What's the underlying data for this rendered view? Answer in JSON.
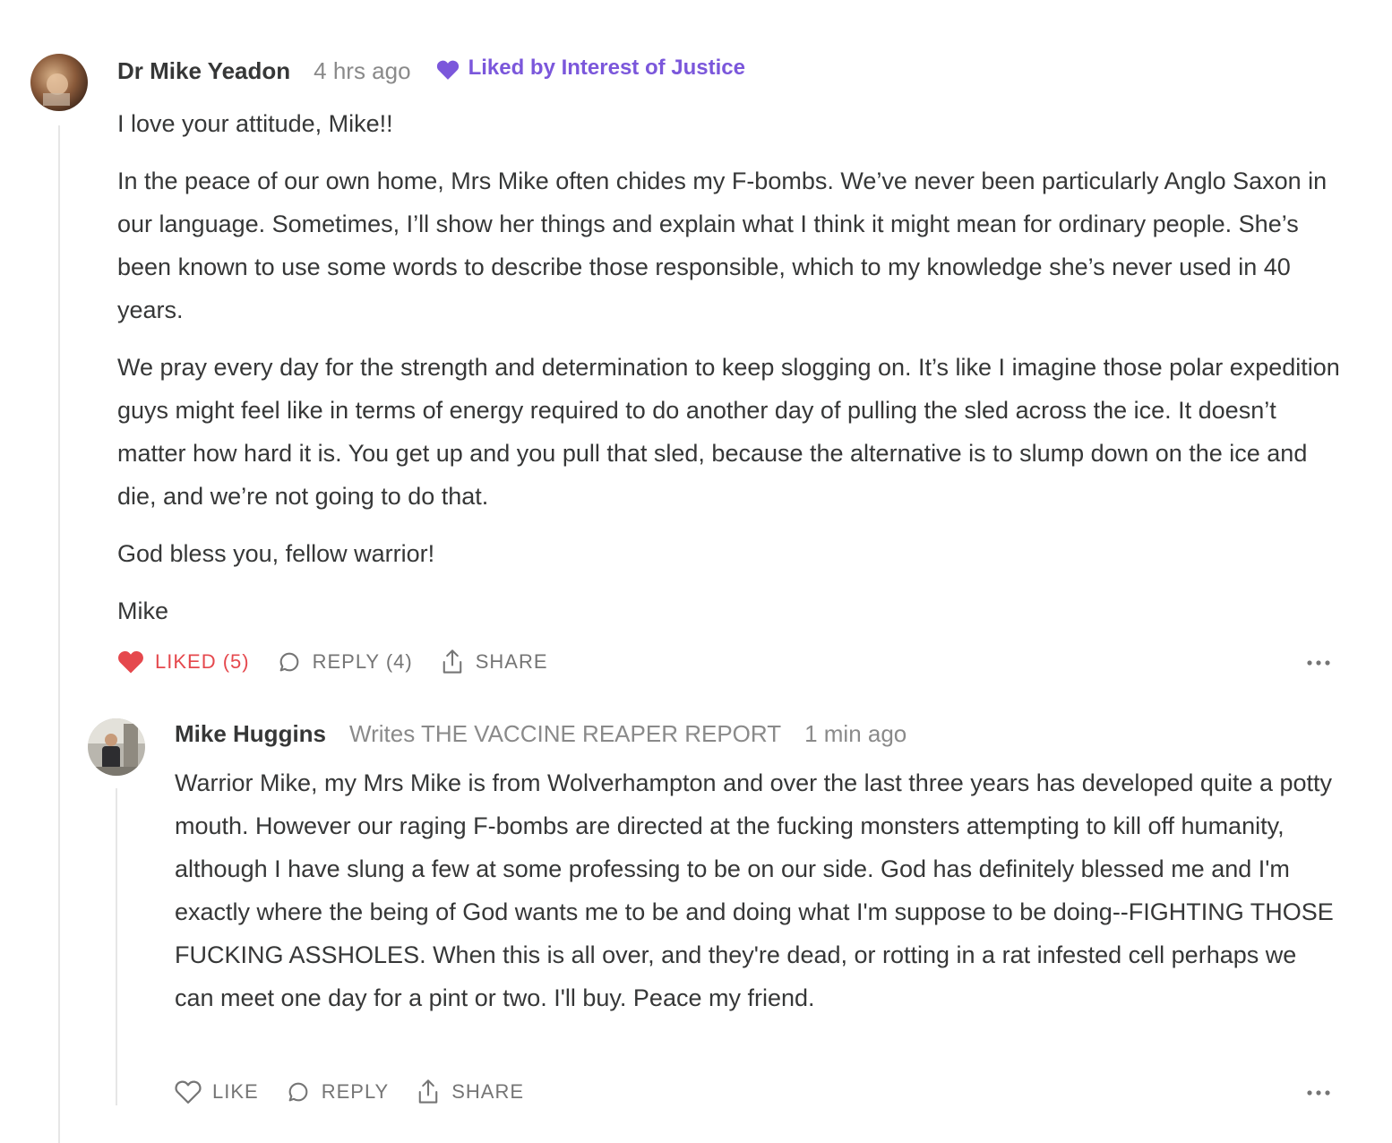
{
  "comments": [
    {
      "author": "Dr Mike Yeadon",
      "timestamp": "4 hrs ago",
      "liked_by": "Liked by Interest of Justice",
      "paragraphs": [
        "I love your attitude, Mike!!",
        "In the peace of our own home, Mrs Mike often chides my F-bombs. We’ve never been particularly Anglo Saxon in our language. Sometimes, I’ll show her things and explain what I think it might mean for ordinary people. She’s been known to use some words to describe those responsible, which to my knowledge she’s never used in 40 years.",
        "We pray every day for the strength and determination to keep slogging on. It’s like I imagine those polar expedition guys might feel like in terms of energy required to do another day of pulling the sled across the ice. It doesn’t matter how hard it is. You get up and you pull that sled, because the alternative is to slump down on the ice and die, and we’re not going to do that.",
        "God bless you, fellow warrior!",
        "Mike"
      ],
      "actions": {
        "like_label": "LIKED (5)",
        "reply_label": "REPLY (4)",
        "share_label": "SHARE"
      }
    },
    {
      "author": "Mike Huggins",
      "writes": "Writes THE VACCINE REAPER REPORT",
      "timestamp": "1 min ago",
      "paragraphs": [
        "Warrior Mike, my Mrs Mike is from Wolverhampton and over the last three years has developed quite a potty mouth. However our raging F-bombs are directed at the fucking monsters attempting to kill off humanity, although I have slung a few at some professing to be on our side. God has definitely blessed me and I'm exactly where the being of God wants me to be and doing what I'm suppose to be doing--FIGHTING THOSE FUCKING ASSHOLES. When this is all over, and they're dead, or rotting in a rat infested cell perhaps we can meet one day for a pint or two. I'll buy. Peace my friend."
      ],
      "actions": {
        "like_label": "LIKE",
        "reply_label": "REPLY",
        "share_label": "SHARE"
      }
    }
  ],
  "colors": {
    "accent_purple": "#7b57db",
    "liked_red": "#e5484d",
    "text": "#363737",
    "muted": "#8a8a8a"
  },
  "icons": {
    "liked_by": "heart-filled-icon",
    "like_active": "heart-filled-icon",
    "like": "heart-outline-icon",
    "reply": "speech-bubble-icon",
    "share": "share-upload-icon",
    "more": "ellipsis-icon"
  }
}
